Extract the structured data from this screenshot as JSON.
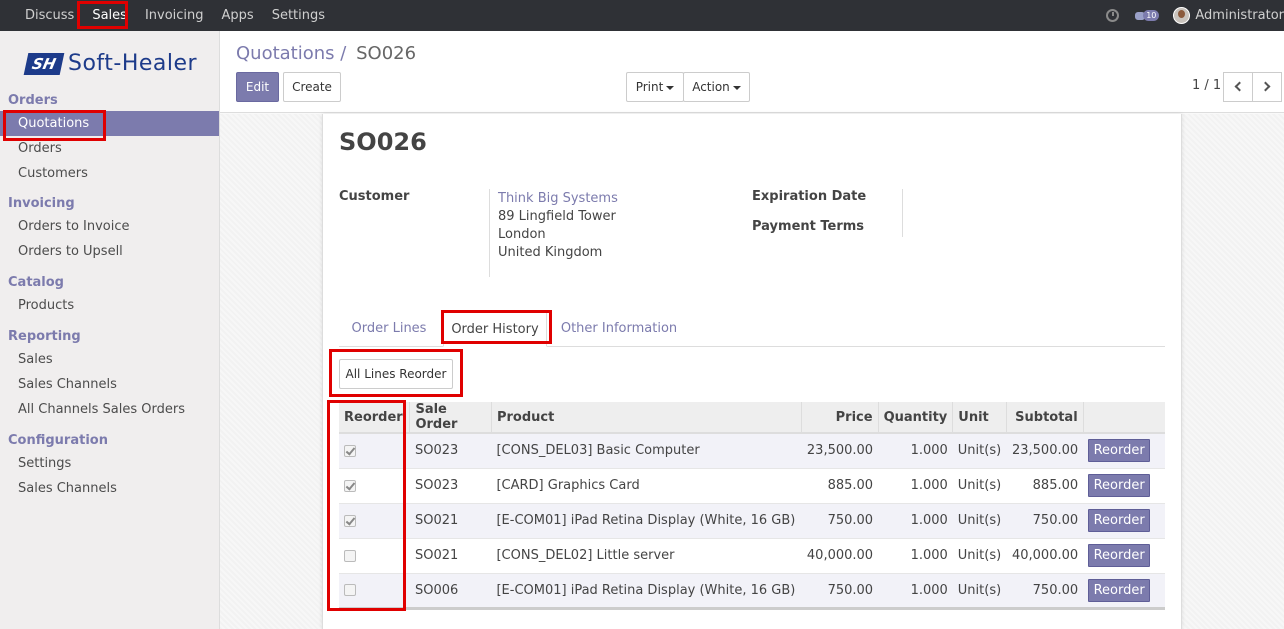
{
  "topbar": {
    "menu": [
      "Discuss",
      "Sales",
      "Invoicing",
      "Apps",
      "Settings"
    ],
    "active": "Sales",
    "chat_count": "10",
    "user": "Administrator"
  },
  "brand": {
    "mark": "SH",
    "name": "Soft-Healer",
    "color": "#1d3b8a"
  },
  "sidebar": {
    "groups": [
      {
        "header": "Orders",
        "items": [
          "Quotations",
          "Orders",
          "Customers"
        ]
      },
      {
        "header": "Invoicing",
        "items": [
          "Orders to Invoice",
          "Orders to Upsell"
        ]
      },
      {
        "header": "Catalog",
        "items": [
          "Products"
        ]
      },
      {
        "header": "Reporting",
        "items": [
          "Sales",
          "Sales Channels",
          "All Channels Sales Orders"
        ]
      },
      {
        "header": "Configuration",
        "items": [
          "Settings",
          "Sales Channels"
        ]
      }
    ],
    "active": "Quotations"
  },
  "breadcrumb": {
    "parent": "Quotations",
    "sep": "/",
    "current": "SO026"
  },
  "toolbar": {
    "edit": "Edit",
    "create": "Create",
    "print": "Print",
    "action": "Action"
  },
  "pager": {
    "text": "1 / 1"
  },
  "form": {
    "title": "SO026",
    "customer_label": "Customer",
    "customer_name": "Think Big Systems",
    "address_1": "89 Lingfield Tower",
    "address_2": "London",
    "address_3": "United Kingdom",
    "expiration_label": "Expiration Date",
    "payment_terms_label": "Payment Terms"
  },
  "tabs": [
    "Order Lines",
    "Order History",
    "Other Information"
  ],
  "active_tab": "Order History",
  "reorder_all_label": "All Lines Reorder",
  "table": {
    "headers": [
      "Reorder",
      "Sale Order",
      "Product",
      "Price",
      "Quantity",
      "Unit",
      "Subtotal",
      ""
    ],
    "row_button": "Reorder",
    "rows": [
      {
        "checked": true,
        "order": "SO023",
        "product": "[CONS_DEL03] Basic Computer",
        "price": "23,500.00",
        "qty": "1.000",
        "unit": "Unit(s)",
        "subtotal": "23,500.00"
      },
      {
        "checked": true,
        "order": "SO023",
        "product": "[CARD] Graphics Card",
        "price": "885.00",
        "qty": "1.000",
        "unit": "Unit(s)",
        "subtotal": "885.00"
      },
      {
        "checked": true,
        "order": "SO021",
        "product": "[E-COM01] iPad Retina Display (White, 16 GB)",
        "price": "750.00",
        "qty": "1.000",
        "unit": "Unit(s)",
        "subtotal": "750.00"
      },
      {
        "checked": false,
        "order": "SO021",
        "product": "[CONS_DEL02] Little server",
        "price": "40,000.00",
        "qty": "1.000",
        "unit": "Unit(s)",
        "subtotal": "40,000.00"
      },
      {
        "checked": false,
        "order": "SO006",
        "product": "[E-COM01] iPad Retina Display (White, 16 GB)",
        "price": "750.00",
        "qty": "1.000",
        "unit": "Unit(s)",
        "subtotal": "750.00"
      }
    ]
  },
  "colors": {
    "accent": "#7c7bad",
    "navbar": "#2f3136",
    "highlight": "#e00000"
  }
}
